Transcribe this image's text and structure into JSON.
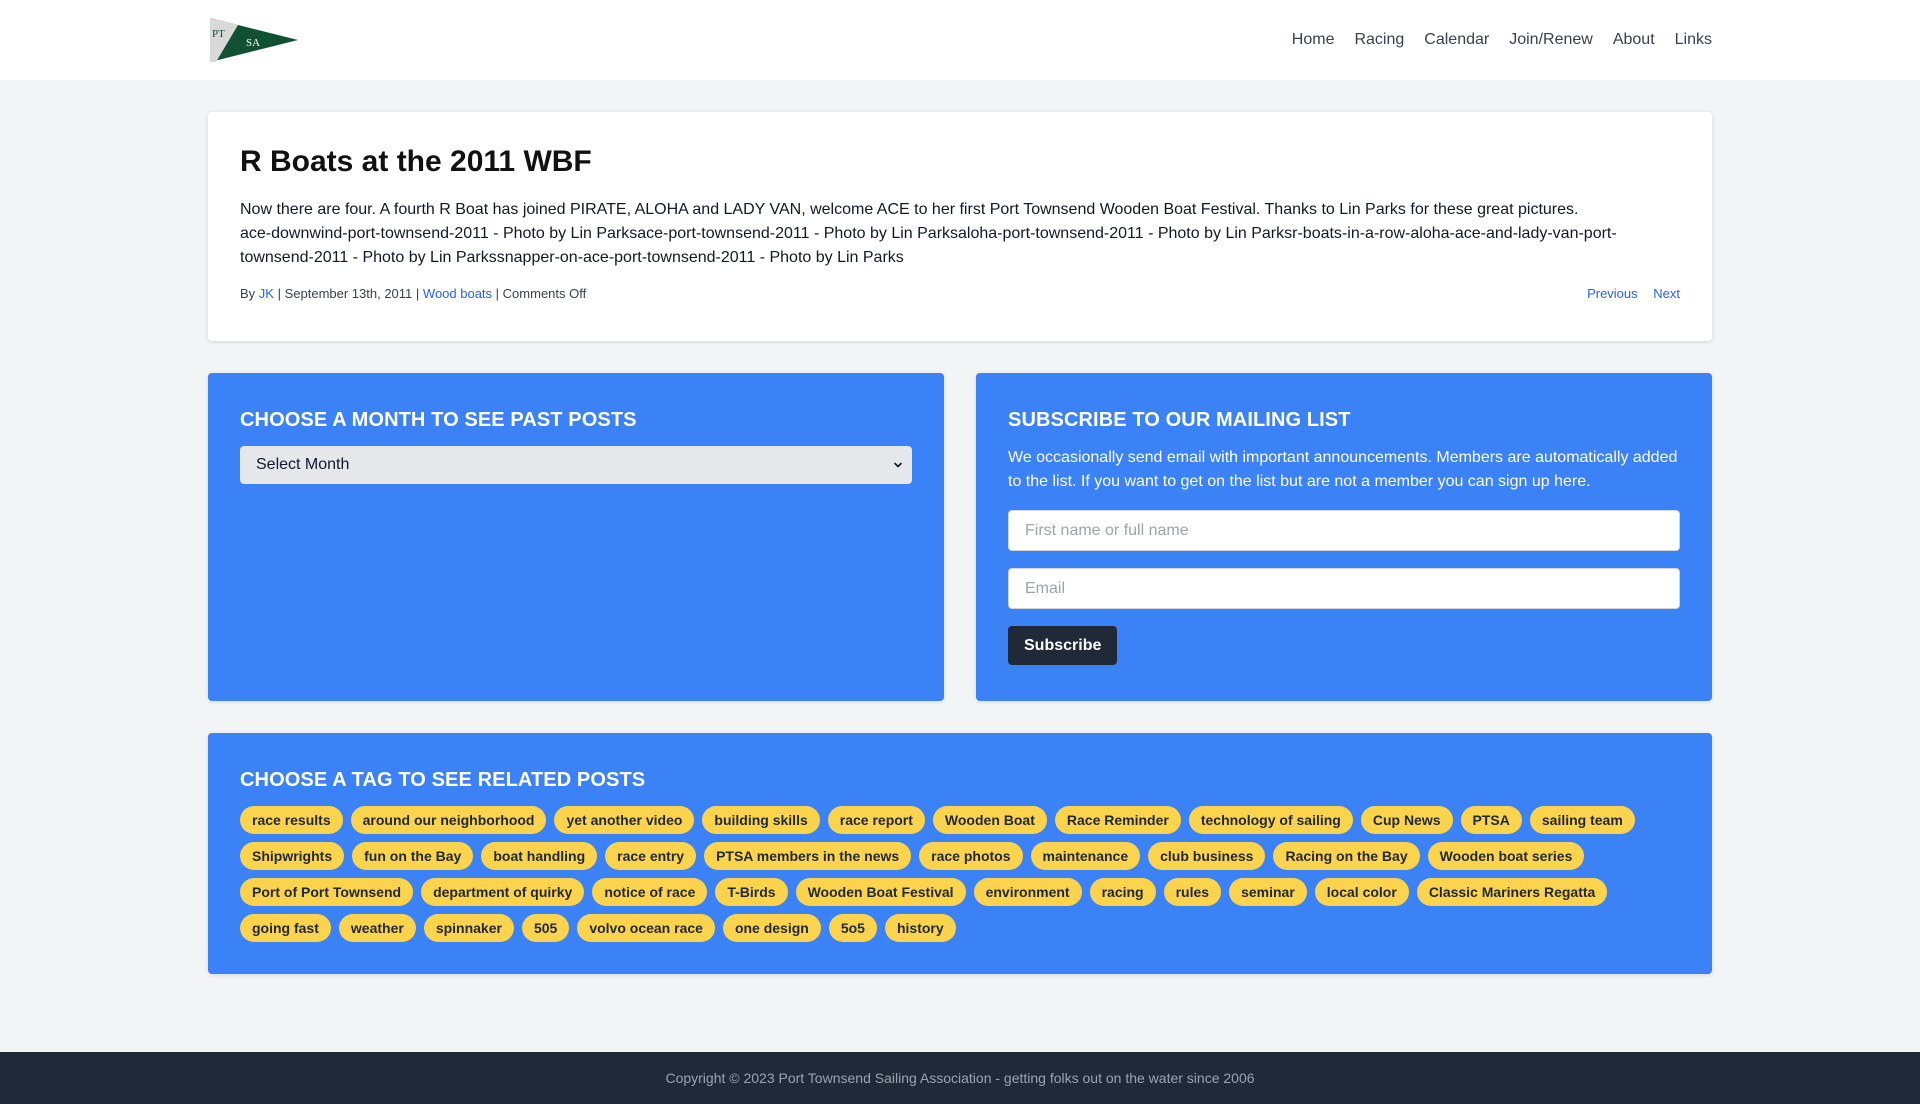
{
  "header": {
    "logo_text_top": "PT",
    "logo_text_bottom": "SA",
    "nav": [
      "Home",
      "Racing",
      "Calendar",
      "Join/Renew",
      "About",
      "Links"
    ]
  },
  "post": {
    "title": "R Boats at the 2011 WBF",
    "body_line1": "Now there are four. A fourth R Boat has joined PIRATE, ALOHA and LADY VAN, welcome ACE to her first Port Townsend Wooden Boat Festival. Thanks to Lin Parks for these great pictures.",
    "body_line2": "ace-downwind-port-townsend-2011 - Photo by Lin Parksace-port-townsend-2011 - Photo by Lin Parksaloha-port-townsend-2011 - Photo by Lin Parksr-boats-in-a-row-aloha-ace-and-lady-van-port-townsend-2011 - Photo by Lin Parkssnapper-on-ace-port-townsend-2011 - Photo by Lin Parks",
    "meta_by": "By",
    "author": "JK",
    "date": "September 13th, 2011",
    "category": "Wood boats",
    "comments": "Comments Off",
    "prev": "Previous",
    "next": "Next"
  },
  "archive": {
    "title": "Choose a month to see past posts",
    "select_value": "Select Month"
  },
  "subscribe": {
    "title": "Subscribe to our mailing list",
    "description": "We occasionally send email with important announcements. Members are automatically added to the list. If you want to get on the list but are not a member you can sign up here.",
    "name_placeholder": "First name or full name",
    "email_placeholder": "Email",
    "button": "Subscribe"
  },
  "tags": {
    "title": "Choose a tag to see related posts",
    "items": [
      "race results",
      "around our neighborhood",
      "yet another video",
      "building skills",
      "race report",
      "Wooden Boat",
      "Race Reminder",
      "technology of sailing",
      "Cup News",
      "PTSA",
      "sailing team",
      "Shipwrights",
      "fun on the Bay",
      "boat handling",
      "race entry",
      "PTSA members in the news",
      "race photos",
      "maintenance",
      "club business",
      "Racing on the Bay",
      "Wooden boat series",
      "Port of Port Townsend",
      "department of quirky",
      "notice of race",
      "T-Birds",
      "Wooden Boat Festival",
      "environment",
      "racing",
      "rules",
      "seminar",
      "local color",
      "Classic Mariners Regatta",
      "going fast",
      "weather",
      "spinnaker",
      "505",
      "volvo ocean race",
      "one design",
      "5o5",
      "history"
    ]
  },
  "footer": {
    "text": "Copyright © 2023 Port Townsend Sailing Association - getting folks out on the water since 2006"
  },
  "colors": {
    "accent_blue": "#3b82f6",
    "tag_yellow": "#fcd34d",
    "footer_dark": "#1f2937",
    "link_blue": "#2563eb",
    "logo_green": "#0f5132"
  }
}
